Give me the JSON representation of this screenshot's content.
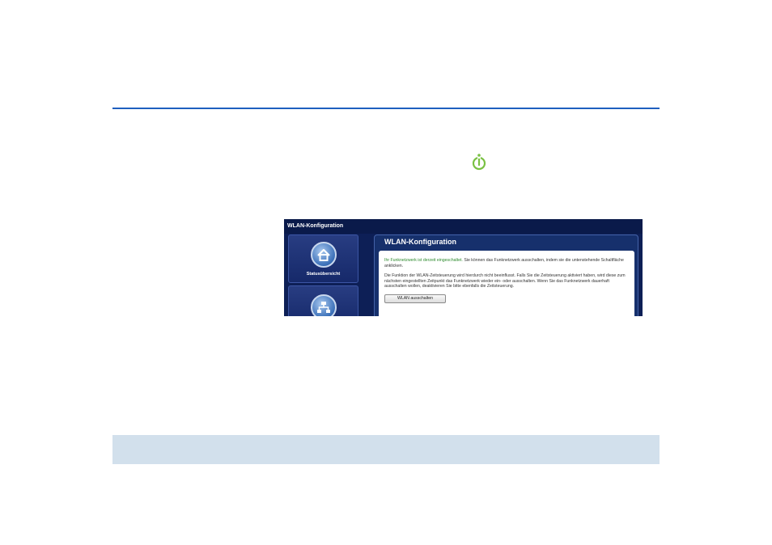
{
  "screenshot": {
    "header_title": "WLAN-Konfiguration",
    "sidebar": {
      "items": [
        {
          "label": "Statusübersicht",
          "icon": "home-icon"
        },
        {
          "label": "",
          "icon": "network-icon"
        }
      ]
    },
    "panel": {
      "title": "WLAN-Konfiguration",
      "status_text": "Ihr Funknetzwerk ist derzeit eingeschaltet.",
      "status_rest": " Sie können das Funknetzwerk ausschalten, indem sie die untenstehende Schaltfläche anklicken.",
      "info_text": "Die Funktion der WLAN-Zeitsteuerung wird hierdurch nicht beeinflusst. Falls Sie die Zeitsteuerung aktiviert haben, wird diese zum nächsten eingestellten Zeitpunkt das Funknetzwerk wieder ein- oder ausschalten. Wenn Sie das Funknetzwerk dauerhaft ausschalten wollen, deaktivieren Sie bitte ebenfalls die Zeitsteuerung.",
      "button_label": "WLAN ausschalten"
    }
  },
  "colors": {
    "rule": "#1f5fbf",
    "power_icon": "#7ac143",
    "bottom_band": "#d2e0ec",
    "status_green": "#2e8b2e"
  },
  "icons": [
    "power-icon",
    "home-icon",
    "network-icon"
  ]
}
